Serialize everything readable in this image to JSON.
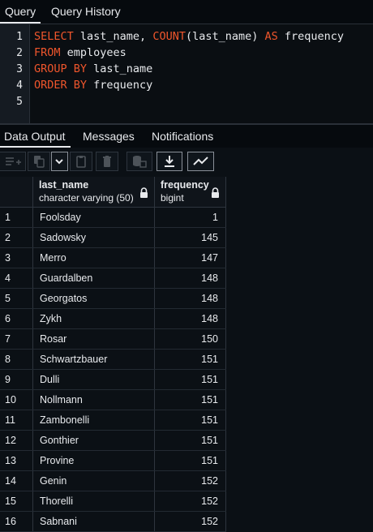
{
  "tabs": [
    {
      "label": "Query",
      "active": true
    },
    {
      "label": "Query History",
      "active": false
    }
  ],
  "editor": {
    "line_numbers": [
      "1",
      "2",
      "3",
      "4",
      "5"
    ]
  },
  "output_tabs": [
    {
      "label": "Data Output",
      "active": true
    },
    {
      "label": "Messages",
      "active": false
    },
    {
      "label": "Notifications",
      "active": false
    }
  ],
  "toolbar": {
    "icons": [
      "add-row-icon",
      "copy-icon",
      "paste-options-icon",
      "paste-icon",
      "delete-icon",
      "save-data-icon",
      "download-icon",
      "graph-icon"
    ]
  },
  "grid": {
    "columns": [
      {
        "name": "last_name",
        "type": "character varying (50)"
      },
      {
        "name": "frequency",
        "type": "bigint"
      }
    ],
    "rows": [
      {
        "idx": "1",
        "last_name": "Foolsday",
        "frequency": "1"
      },
      {
        "idx": "2",
        "last_name": "Sadowsky",
        "frequency": "145"
      },
      {
        "idx": "3",
        "last_name": "Merro",
        "frequency": "147"
      },
      {
        "idx": "4",
        "last_name": "Guardalben",
        "frequency": "148"
      },
      {
        "idx": "5",
        "last_name": "Georgatos",
        "frequency": "148"
      },
      {
        "idx": "6",
        "last_name": "Zykh",
        "frequency": "148"
      },
      {
        "idx": "7",
        "last_name": "Rosar",
        "frequency": "150"
      },
      {
        "idx": "8",
        "last_name": "Schwartzbauer",
        "frequency": "151"
      },
      {
        "idx": "9",
        "last_name": "Dulli",
        "frequency": "151"
      },
      {
        "idx": "10",
        "last_name": "Nollmann",
        "frequency": "151"
      },
      {
        "idx": "11",
        "last_name": "Zambonelli",
        "frequency": "151"
      },
      {
        "idx": "12",
        "last_name": "Gonthier",
        "frequency": "151"
      },
      {
        "idx": "13",
        "last_name": "Provine",
        "frequency": "151"
      },
      {
        "idx": "14",
        "last_name": "Genin",
        "frequency": "152"
      },
      {
        "idx": "15",
        "last_name": "Thorelli",
        "frequency": "152"
      },
      {
        "idx": "16",
        "last_name": "Sabnani",
        "frequency": "152"
      }
    ]
  },
  "code": {
    "l1": {
      "kw1": "SELECT",
      "t1": " last_name, ",
      "kw2": "COUNT",
      "t2": "(last_name) ",
      "kw3": "AS",
      "t3": " frequency"
    },
    "l2": {
      "kw1": "FROM",
      "t1": " employees"
    },
    "l3": {
      "kw1": "GROUP BY",
      "t1": " last_name"
    },
    "l4": {
      "kw1": "ORDER BY",
      "t1": " frequency"
    }
  },
  "colors": {
    "keyword": "#f0562c",
    "background": "#0b1015",
    "text": "#e8eaed"
  }
}
